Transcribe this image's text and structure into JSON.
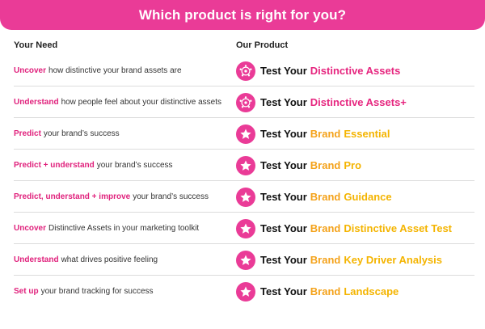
{
  "header": {
    "title": "Which product is right for you?"
  },
  "columns": {
    "need": "Your Need",
    "product": "Our Product"
  },
  "colors": {
    "brand_pink": "#ea3b97",
    "need_pink": "#e0217c",
    "assets_pink": "#e6267f",
    "brand_orange": "#f4a21a",
    "product_yellow": "#f4b400"
  },
  "rows": [
    {
      "need_strong": "Uncover",
      "need_rest": "how distinctive your brand assets are",
      "icon": "distinctive-assets-icon",
      "product_base": "Test Your",
      "product_brand": "",
      "product_name": "Distinctive Assets"
    },
    {
      "need_strong": "Understand",
      "need_rest": "how people feel about your distinctive assets",
      "icon": "distinctive-assets-icon",
      "product_base": "Test Your",
      "product_brand": "",
      "product_name": "Distinctive Assets+"
    },
    {
      "need_strong": "Predict",
      "need_rest": "your brand’s success",
      "icon": "star-icon",
      "product_base": "Test Your",
      "product_brand": "Brand",
      "product_name": "Essential"
    },
    {
      "need_strong": "Predict + understand",
      "need_rest": "your brand’s success",
      "icon": "star-icon",
      "product_base": "Test Your",
      "product_brand": "Brand",
      "product_name": "Pro"
    },
    {
      "need_strong": "Predict, understand + improve",
      "need_rest": "your brand’s success",
      "icon": "star-icon",
      "product_base": "Test Your",
      "product_brand": "Brand",
      "product_name": "Guidance"
    },
    {
      "need_strong": "Uncover",
      "need_rest": "Distinctive Assets in your marketing toolkit",
      "icon": "star-icon",
      "product_base": "Test Your",
      "product_brand": "Brand",
      "product_name": "Distinctive Asset Test"
    },
    {
      "need_strong": "Understand",
      "need_rest": "what drives positive feeling",
      "icon": "star-icon",
      "product_base": "Test Your",
      "product_brand": "Brand",
      "product_name": "Key Driver Analysis"
    },
    {
      "need_strong": "Set up",
      "need_rest": "your brand tracking for success",
      "icon": "star-icon",
      "product_base": "Test Your",
      "product_brand": "Brand",
      "product_name": "Landscape"
    }
  ]
}
